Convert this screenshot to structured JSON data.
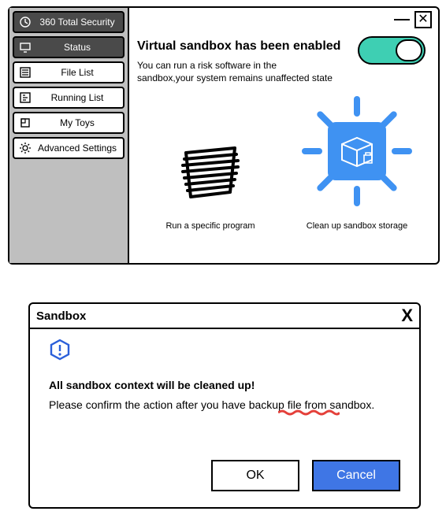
{
  "app_title": "360 Total Security",
  "sidebar": {
    "items": [
      {
        "label": "360 Total Security",
        "icon": "shield-icon"
      },
      {
        "label": "Status",
        "icon": "monitor-icon"
      },
      {
        "label": "File List",
        "icon": "list-icon"
      },
      {
        "label": "Running List",
        "icon": "running-icon"
      },
      {
        "label": "My Toys",
        "icon": "toys-icon"
      },
      {
        "label": "Advanced Settings",
        "icon": "gear-icon"
      }
    ]
  },
  "main": {
    "heading": "Virtual sandbox has been enabled",
    "subheading": "You can run a risk software in the sandbox,your system remains unaffected state",
    "toggle_on": true,
    "cards": {
      "run": {
        "caption": "Run a specific program"
      },
      "clean": {
        "caption": "Clean up sandbox storage"
      }
    }
  },
  "dialog": {
    "title": "Sandbox",
    "line1": "All sandbox context will be cleaned up!",
    "line2": "Please confirm the action after you have backup file from sandbox.",
    "ok_label": "OK",
    "cancel_label": "Cancel"
  }
}
